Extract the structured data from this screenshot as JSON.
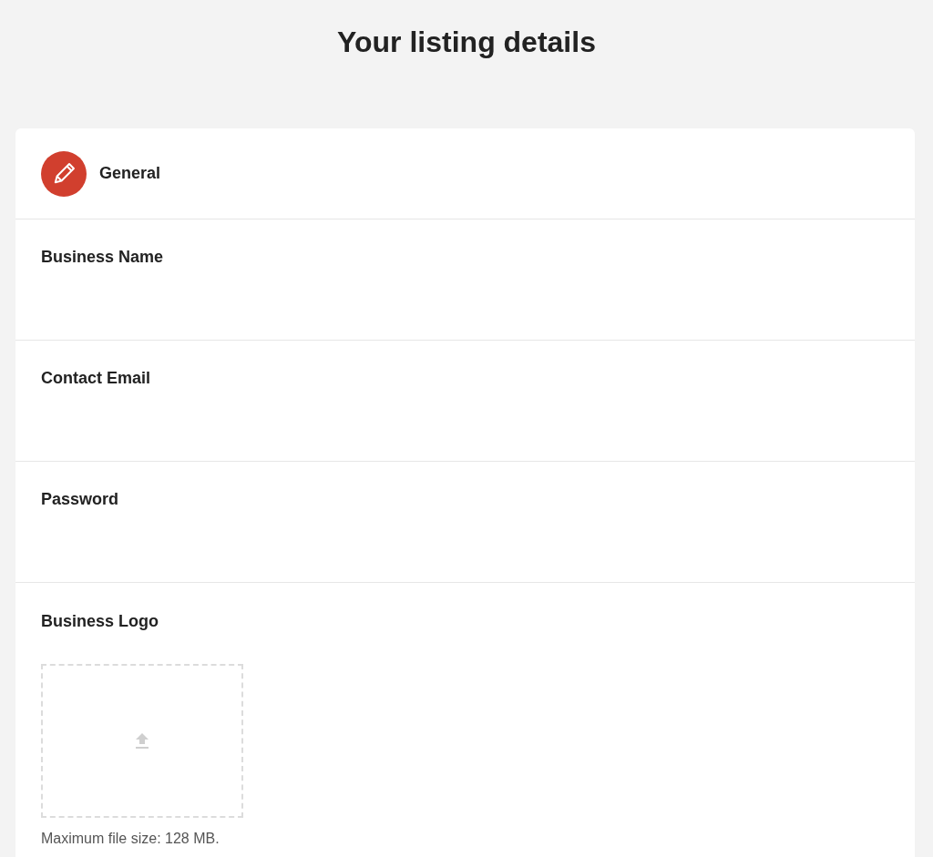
{
  "page": {
    "title": "Your listing details"
  },
  "section": {
    "title": "General",
    "fields": [
      {
        "kind": "text",
        "label": "Business Name"
      },
      {
        "kind": "text",
        "label": "Contact Email"
      },
      {
        "kind": "text",
        "label": "Password"
      },
      {
        "kind": "upload",
        "label": "Business Logo",
        "note": "Maximum file size: 128 MB."
      }
    ]
  }
}
